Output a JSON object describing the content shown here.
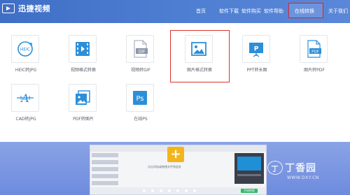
{
  "app": {
    "title": "迅捷视频"
  },
  "nav": {
    "items": [
      {
        "label": "首页"
      },
      {
        "label": "软件下载"
      },
      {
        "label": "软件购买"
      },
      {
        "label": "软件帮助"
      },
      {
        "label": "在线转换"
      },
      {
        "label": "关于我们"
      }
    ],
    "active_index": 4
  },
  "tools": [
    {
      "label": "HEIC转JPG",
      "icon": "heic-icon"
    },
    {
      "label": "视频格式转换",
      "icon": "video-convert-icon"
    },
    {
      "label": "视频转GIF",
      "icon": "gif-icon"
    },
    {
      "label": "图片格式转换",
      "icon": "image-icon"
    },
    {
      "label": "PPT转长图",
      "icon": "ppt-icon"
    },
    {
      "label": "图片转PDF",
      "icon": "pdf-icon"
    },
    {
      "label": "CAD转JPG",
      "icon": "cad-icon"
    },
    {
      "label": "PDF转图片",
      "icon": "pdf-image-icon"
    },
    {
      "label": "在线PS",
      "icon": "ps-icon"
    }
  ],
  "icon_text": {
    "heic": "HEIC",
    "gif": "GIF",
    "ppt": "P",
    "pdf": "PDF",
    "cad": "A",
    "ps": "Ps"
  },
  "banner": {
    "plus": "+",
    "preview_hint": "点击添加或拖拽文件到此处",
    "convert_button": "开始转换",
    "dots_count": 7
  },
  "watermark": {
    "title": "丁香园",
    "sub": "WWW.DXY.CN",
    "mark": "丁"
  },
  "colors": {
    "header": "#4a78cf",
    "accent_blue": "#1f8fd6",
    "highlight_red": "#d9342b",
    "banner": "#7a93e0"
  }
}
